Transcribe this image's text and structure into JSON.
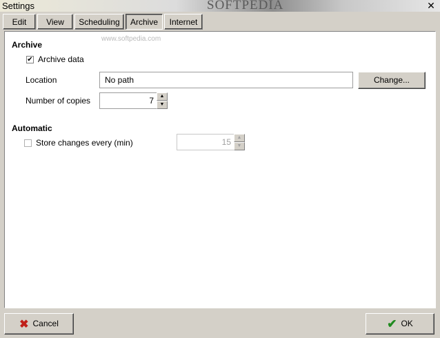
{
  "window": {
    "title": "Settings",
    "watermark": "SOFTPEDIA",
    "watermark_small": "www.softpedia.com",
    "close_glyph": "✕"
  },
  "tabs": [
    {
      "label": "Edit",
      "active": false
    },
    {
      "label": "View",
      "active": false
    },
    {
      "label": "Scheduling",
      "active": false
    },
    {
      "label": "Archive",
      "active": true
    },
    {
      "label": "Internet",
      "active": false
    }
  ],
  "archive": {
    "heading": "Archive",
    "archive_data_label": "Archive data",
    "archive_data_checked": true,
    "location_label": "Location",
    "location_value": "No path",
    "change_button": "Change...",
    "copies_label": "Number of copies",
    "copies_value": "7"
  },
  "automatic": {
    "heading": "Automatic",
    "store_label": "Store changes every (min)",
    "store_checked": false,
    "store_value": "15"
  },
  "footer": {
    "cancel_label": "Cancel",
    "ok_label": "OK",
    "cancel_icon": "x-icon",
    "ok_icon": "checkmark-icon",
    "cancel_color": "#c0201a",
    "ok_color": "#1f8a1f"
  }
}
